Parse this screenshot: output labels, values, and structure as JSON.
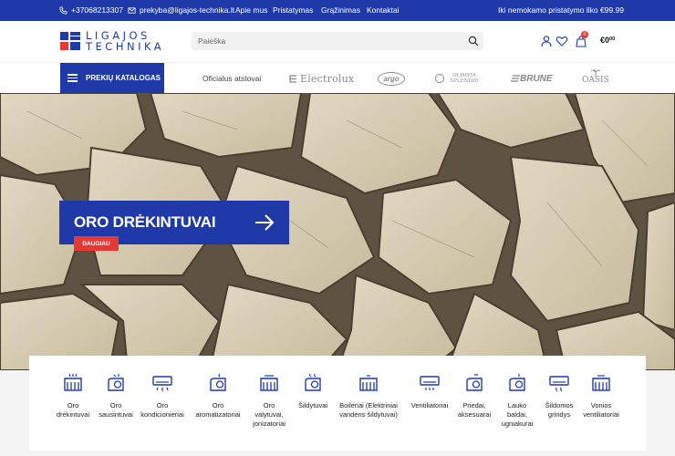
{
  "topbar": {
    "phone": "+37068213307",
    "email": "prekyba@ligajos-technika.lt",
    "links": [
      "Apie mus",
      "Pristatymas",
      "Grąžinimas",
      "Kontaktai"
    ],
    "shipping_note": "Iki nemokamo pristatymo liko €99.99"
  },
  "header": {
    "logo_line1": "LIGAJOS",
    "logo_line2": "TECHNIKA",
    "search_placeholder": "Paieška",
    "cart_count": "0",
    "cart_total": "€0",
    "cart_total_cents": "00"
  },
  "nav": {
    "catalog_label": "PREKIŲ KATALOGAS",
    "official_label": "Oficialus atstovai",
    "brands": [
      "Electrolux",
      "argo",
      "OLIMPIA SPLENDID",
      "BRUNE",
      "OASIS"
    ]
  },
  "hero": {
    "title": "ORO DRĖKINTUVAI",
    "cta_label": "DAUGIAU"
  },
  "categories": [
    {
      "line1": "Oro",
      "line2": "drėkintuvai",
      "line3": ""
    },
    {
      "line1": "Oro",
      "line2": "sausintuvai",
      "line3": ""
    },
    {
      "line1": "Oro",
      "line2": "kondicionieriai",
      "line3": ""
    },
    {
      "line1": "Oro",
      "line2": "aromatizatoriai",
      "line3": ""
    },
    {
      "line1": "Oro",
      "line2": "valytuvai,",
      "line3": "jonizatoriai"
    },
    {
      "line1": "Šildytuvai",
      "line2": "",
      "line3": ""
    },
    {
      "line1": "Boileriai (Elektriniai",
      "line2": "vandens šildytuvai)",
      "line3": ""
    },
    {
      "line1": "Ventiliatoriai",
      "line2": "",
      "line3": ""
    },
    {
      "line1": "Priedai,",
      "line2": "aksesuarai",
      "line3": ""
    },
    {
      "line1": "Lauko",
      "line2": "baldai,",
      "line3": "ugniakurai"
    },
    {
      "line1": "Šildomos",
      "line2": "grindys",
      "line3": ""
    },
    {
      "line1": "Vonios",
      "line2": "ventiliatoriai",
      "line3": ""
    }
  ],
  "colors": {
    "brand_blue": "#1f3aa8",
    "accent_red": "#e53935"
  }
}
